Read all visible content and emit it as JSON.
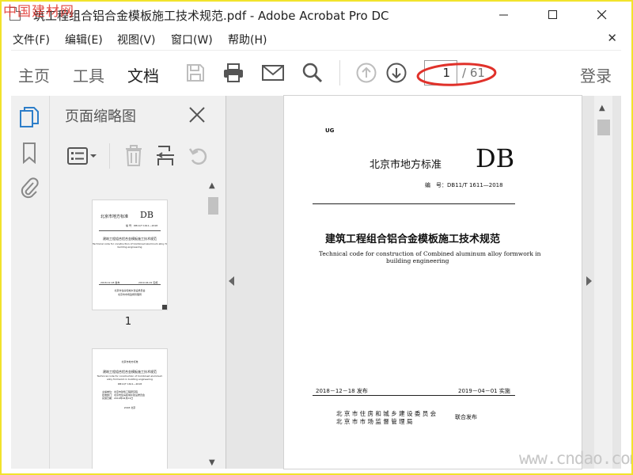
{
  "watermark_top": "中国建材网",
  "window": {
    "title": "筑工程组合铝合金模板施工技术规范.pdf - Adobe Acrobat Pro DC"
  },
  "menu": [
    "文件(F)",
    "编辑(E)",
    "视图(V)",
    "窗口(W)",
    "帮助(H)"
  ],
  "toolbar": {
    "tabs": [
      "主页",
      "工具",
      "文档"
    ],
    "active_tab": "文档",
    "icons": [
      "save-icon",
      "print-icon",
      "mail-icon",
      "search-icon",
      "page-up-icon",
      "page-down-icon"
    ],
    "page_current": "1",
    "page_total": "/ 61",
    "login": "登录"
  },
  "rail_icons": [
    "page-thumbnails-icon",
    "bookmark-icon",
    "attachment-icon"
  ],
  "thumb_panel": {
    "title": "页面缩略图",
    "tools": [
      "thumbnail-options-icon",
      "delete-page-icon",
      "insert-page-icon",
      "rotate-page-icon"
    ],
    "thumbnails": [
      {
        "label": "1"
      }
    ]
  },
  "document": {
    "code_mark": "UG",
    "standard_type": "北京市地方标准",
    "db_mark": "DB",
    "number": "编　号：DB11/T 1611—2018",
    "title_cn": "建筑工程组合铝合金模板施工技术规范",
    "title_en_1": "Technical code for construction of Combined aluminum alloy formwork in",
    "title_en_2": "building engineering",
    "issue_date": "2018－12－18 发布",
    "impl_date": "2019－04－01 实施",
    "issuer_1": "北 京 市 住 房 和 城 乡 建 设 委 员 会",
    "issuer_2": "北 京 市 市 场 监 督 管 理 局",
    "joint": "联合发布"
  },
  "watermark_bottom": "www.cndao.com",
  "colors": {
    "frame": "#f2e32b",
    "annotation": "#e0312a",
    "panel_bg": "#f0f0f0",
    "doc_bg": "#e6e6e6"
  }
}
